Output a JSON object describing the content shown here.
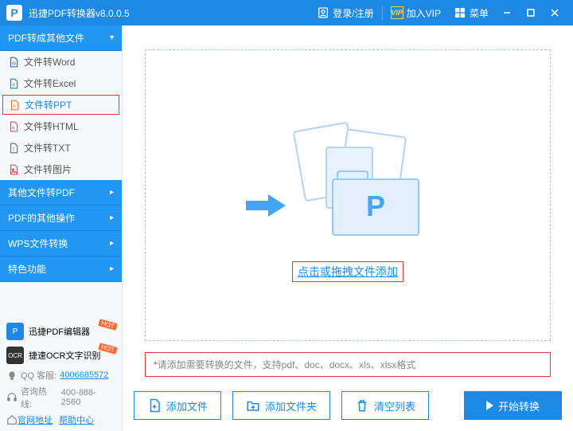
{
  "titlebar": {
    "app_name": "迅捷PDF转换器v8.0.0.5",
    "login": "登录/注册",
    "vip": "加入VIP",
    "vip_badge": "VIP",
    "menu": "菜单"
  },
  "sidebar": {
    "categories": [
      {
        "label": "PDF转成其他文件",
        "expanded": true
      },
      {
        "label": "其他文件转PDF",
        "expanded": false
      },
      {
        "label": "PDF的其他操作",
        "expanded": false
      },
      {
        "label": "WPS文件转换",
        "expanded": false
      },
      {
        "label": "特色功能",
        "expanded": false
      }
    ],
    "items": [
      {
        "label": "文件转Word",
        "color": "#2a6fd6"
      },
      {
        "label": "文件转Excel",
        "color": "#1f9d55"
      },
      {
        "label": "文件转PPT",
        "color": "#e07b2e",
        "selected": true
      },
      {
        "label": "文件转HTML",
        "color": "#e0524d"
      },
      {
        "label": "文件转TXT",
        "color": "#6a6a6a"
      },
      {
        "label": "文件转图片",
        "color": "#e0524d"
      }
    ],
    "promos": [
      {
        "label": "迅捷PDF编辑器",
        "badge": "HOT",
        "bg": "#1e88e5"
      },
      {
        "label": "捷速OCR文字识别",
        "badge": "HOT",
        "bg": "#333"
      }
    ],
    "contact": {
      "qq_label": "QQ 客服:",
      "qq_value": "4006685572",
      "phone_label": "咨询热线:",
      "phone_value": "400-888-2560",
      "site": "官网地址",
      "help": "帮助中心"
    }
  },
  "drop": {
    "text": "点击或拖拽文件添加",
    "hint": "请添加需要转换的文件，支持pdf、doc、docx、xls、xlsx格式"
  },
  "footer": {
    "add_file": "添加文件",
    "add_folder": "添加文件夹",
    "clear": "清空列表",
    "start": "开始转换"
  }
}
